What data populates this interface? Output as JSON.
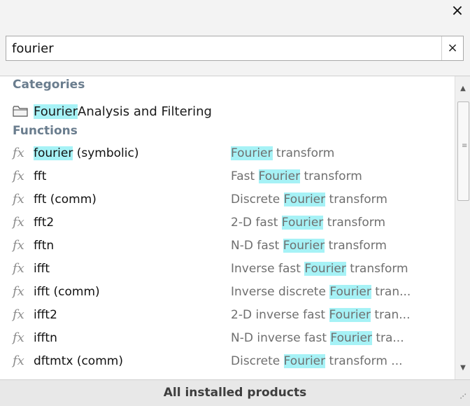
{
  "window": {
    "close_glyph": "×"
  },
  "search": {
    "value": "fourier",
    "clear_glyph": "×"
  },
  "categories_header": "Categories",
  "category": {
    "match": "Fourier",
    "rest": " Analysis and Filtering"
  },
  "functions_header": "Functions",
  "functions": [
    {
      "name_match": "fourier",
      "name_rest": " (symbolic)",
      "desc_pre": "",
      "desc_match": "Fourier",
      "desc_post": " transform"
    },
    {
      "name_match": "",
      "name_rest": "fft",
      "desc_pre": "Fast ",
      "desc_match": "Fourier",
      "desc_post": " transform"
    },
    {
      "name_match": "",
      "name_rest": "fft (comm)",
      "desc_pre": "Discrete ",
      "desc_match": "Fourier",
      "desc_post": " transform"
    },
    {
      "name_match": "",
      "name_rest": "fft2",
      "desc_pre": "2-D fast ",
      "desc_match": "Fourier",
      "desc_post": " transform"
    },
    {
      "name_match": "",
      "name_rest": "fftn",
      "desc_pre": "N-D fast ",
      "desc_match": "Fourier",
      "desc_post": " transform"
    },
    {
      "name_match": "",
      "name_rest": "ifft",
      "desc_pre": "Inverse fast ",
      "desc_match": "Fourier",
      "desc_post": " transform"
    },
    {
      "name_match": "",
      "name_rest": "ifft (comm)",
      "desc_pre": "Inverse discrete ",
      "desc_match": "Fourier",
      "desc_post": " tran..."
    },
    {
      "name_match": "",
      "name_rest": "ifft2",
      "desc_pre": "2-D inverse fast ",
      "desc_match": "Fourier",
      "desc_post": " tran..."
    },
    {
      "name_match": "",
      "name_rest": "ifftn",
      "desc_pre": "N-D inverse fast ",
      "desc_match": "Fourier",
      "desc_post": " tra..."
    },
    {
      "name_match": "",
      "name_rest": "dftmtx (comm)",
      "desc_pre": "Discrete ",
      "desc_match": "Fourier",
      "desc_post": " transform ..."
    }
  ],
  "fx_glyph": "fx",
  "footer_label": "All installed products",
  "colors": {
    "highlight": "#a6f2f6",
    "header": "#6a7d8e",
    "desc": "#6f6f6f"
  },
  "icons": {
    "category": "folder-icon",
    "function": "fx-icon"
  }
}
